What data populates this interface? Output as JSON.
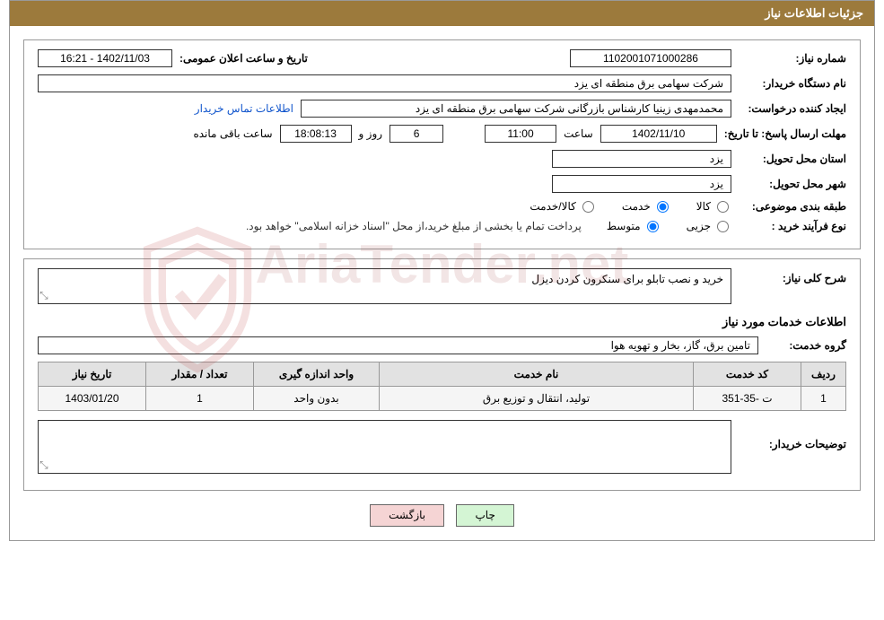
{
  "header": {
    "title": "جزئیات اطلاعات نیاز"
  },
  "form": {
    "need_number_label": "شماره نیاز:",
    "need_number": "1102001071000286",
    "announce_date_label": "تاریخ و ساعت اعلان عمومی:",
    "announce_date": "1402/11/03 - 16:21",
    "buyer_org_label": "نام دستگاه خریدار:",
    "buyer_org": "شرکت سهامی برق منطقه ای یزد",
    "requester_label": "ایجاد کننده درخواست:",
    "requester": "محمدمهدی زینیا کارشناس بازرگانی شرکت سهامی برق منطقه ای یزد",
    "contact_link": "اطلاعات تماس خریدار",
    "deadline_label": "مهلت ارسال پاسخ: تا تاریخ:",
    "deadline_date": "1402/11/10",
    "time_label": "ساعت",
    "deadline_time": "11:00",
    "days_remaining": "6",
    "days_label": "روز و",
    "countdown": "18:08:13",
    "remaining_label": "ساعت باقی مانده",
    "province_label": "استان محل تحویل:",
    "province": "یزد",
    "city_label": "شهر محل تحویل:",
    "city": "یزد",
    "topic_class_label": "طبقه بندی موضوعی:",
    "radio_goods": "کالا",
    "radio_service": "خدمت",
    "radio_goods_service": "کالا/خدمت",
    "purchase_type_label": "نوع فرآیند خرید :",
    "radio_minor": "جزیی",
    "radio_medium": "متوسط",
    "payment_note": "پرداخت تمام یا بخشی از مبلغ خرید،از محل \"اسناد خزانه اسلامی\" خواهد بود."
  },
  "section2": {
    "general_desc_label": "شرح کلی نیاز:",
    "general_desc": "خرید و نصب تابلو برای سنکرون کردن دیزل",
    "services_title": "اطلاعات خدمات مورد نیاز",
    "service_group_label": "گروه خدمت:",
    "service_group": "تامین برق، گاز، بخار و تهویه هوا",
    "table": {
      "headers": {
        "row": "ردیف",
        "code": "کد خدمت",
        "name": "نام خدمت",
        "unit": "واحد اندازه گیری",
        "qty": "تعداد / مقدار",
        "date": "تاریخ نیاز"
      },
      "rows": [
        {
          "num": "1",
          "code": "ت -35-351",
          "name": "تولید، انتقال و توزیع برق",
          "unit": "بدون واحد",
          "qty": "1",
          "date": "1403/01/20"
        }
      ]
    },
    "buyer_notes_label": "توضیحات خریدار:",
    "buyer_notes": ""
  },
  "buttons": {
    "print": "چاپ",
    "back": "بازگشت"
  },
  "watermark": "AriaTender.net"
}
